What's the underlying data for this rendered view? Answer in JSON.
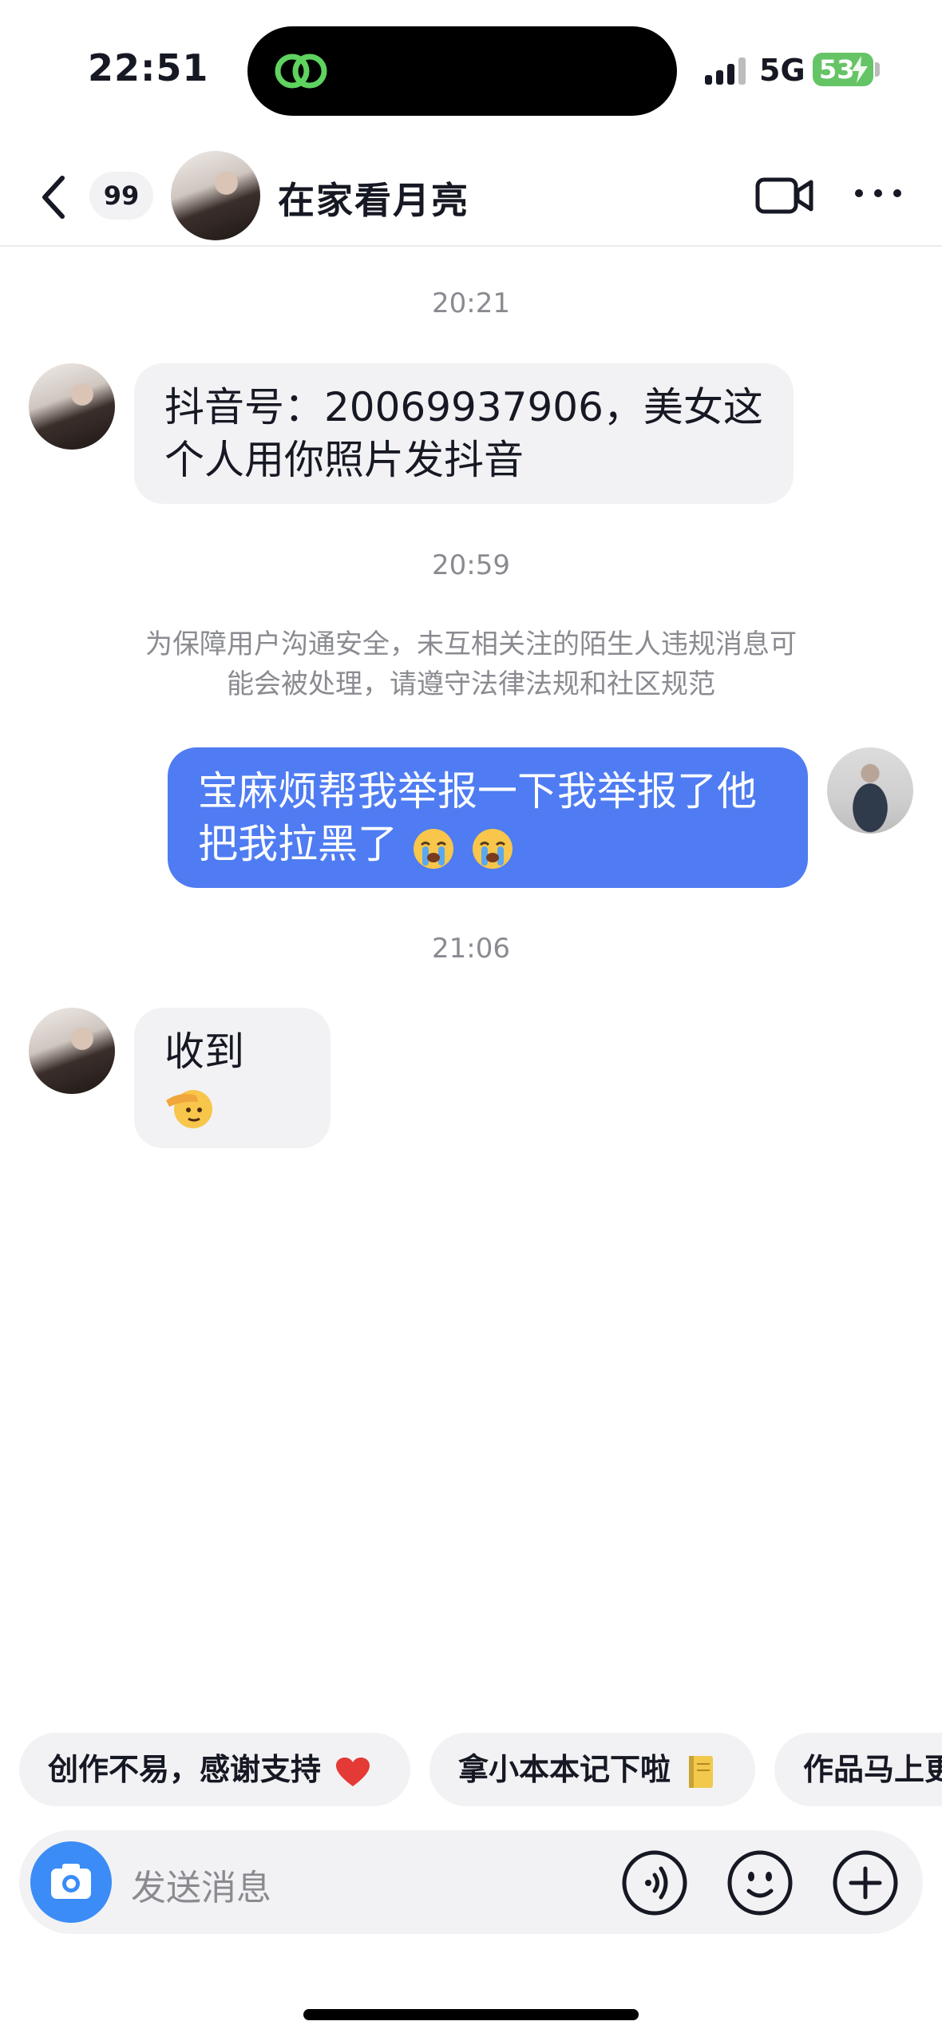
{
  "status_bar": {
    "time": "22:51",
    "network": "5G",
    "battery": "53"
  },
  "header": {
    "unread_count": "99",
    "title": "在家看月亮"
  },
  "messages": {
    "t1": "20:21",
    "m1_line1": "抖音号：20069937906，美女这",
    "m1_line2": "个人用你照片发抖音",
    "t2": "20:59",
    "notice_line1": "为保障用户沟通安全，未互相关注的陌生人违规消息可",
    "notice_line2": "能会被处理，请遵守法律法规和社区规范",
    "m2_line1": "宝麻烦帮我举报一下我举报了他",
    "m2_line2": "把我拉黑了",
    "t3": "21:06",
    "m3": "收到"
  },
  "quick_replies": [
    "创作不易，感谢支持",
    "拿小本本记下啦",
    "作品马上更"
  ],
  "input": {
    "placeholder": "发送消息"
  },
  "colors": {
    "outgoing_bubble": "#4f7cf2",
    "incoming_bubble": "#f2f2f4",
    "camera_button": "#3b8cf7",
    "battery": "#65c466"
  }
}
